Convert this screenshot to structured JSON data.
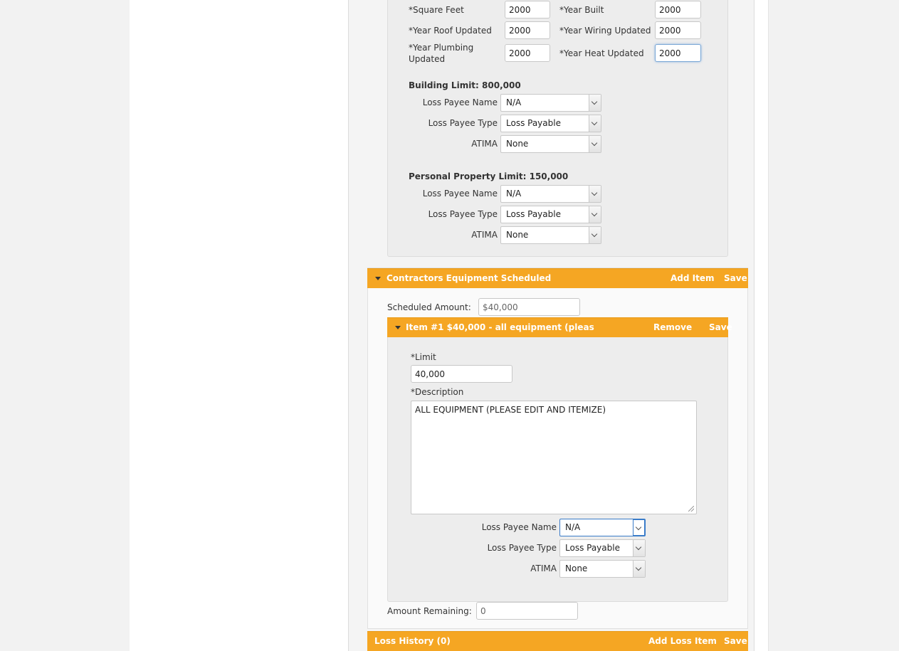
{
  "building": {
    "square_feet_label": "*Square Feet",
    "square_feet": "2000",
    "year_built_label": "*Year Built",
    "year_built": "2000",
    "year_roof_label": "*Year Roof Updated",
    "year_roof": "2000",
    "year_wiring_label": "*Year Wiring Updated",
    "year_wiring": "2000",
    "year_plumbing_label": "*Year Plumbing Updated",
    "year_plumbing": "2000",
    "year_heat_label": "*Year Heat Updated",
    "year_heat": "2000"
  },
  "building_limit": {
    "heading": "Building Limit: 800,000",
    "loss_payee_name_label": "Loss Payee Name",
    "loss_payee_name": "N/A",
    "loss_payee_type_label": "Loss Payee Type",
    "loss_payee_type": "Loss Payable",
    "atima_label": "ATIMA",
    "atima": "None"
  },
  "personal_property": {
    "heading": "Personal Property Limit: 150,000",
    "loss_payee_name_label": "Loss Payee Name",
    "loss_payee_name": "N/A",
    "loss_payee_type_label": "Loss Payee Type",
    "loss_payee_type": "Loss Payable",
    "atima_label": "ATIMA",
    "atima": "None"
  },
  "contractors": {
    "title": "Contractors Equipment Scheduled",
    "add_item": "Add Item",
    "save": "Save",
    "scheduled_amount_label": "Scheduled Amount:",
    "scheduled_amount": "$40,000",
    "amount_remaining_label": "Amount Remaining:",
    "amount_remaining": "0"
  },
  "item": {
    "title": "Item #1 $40,000 - all equipment (pleas",
    "remove": "Remove",
    "save": "Save",
    "limit_label": "*Limit",
    "limit": "40,000",
    "description_label": "*Description",
    "description": "ALL EQUIPMENT (PLEASE EDIT AND ITEMIZE)",
    "loss_payee_name_label": "Loss Payee Name",
    "loss_payee_name": "N/A",
    "loss_payee_type_label": "Loss Payee Type",
    "loss_payee_type": "Loss Payable",
    "atima_label": "ATIMA",
    "atima": "None"
  },
  "loss_history": {
    "title": "Loss History (0)",
    "add_loss_item": "Add Loss Item",
    "save": "Save"
  },
  "colors": {
    "accent": "#f5a623"
  }
}
